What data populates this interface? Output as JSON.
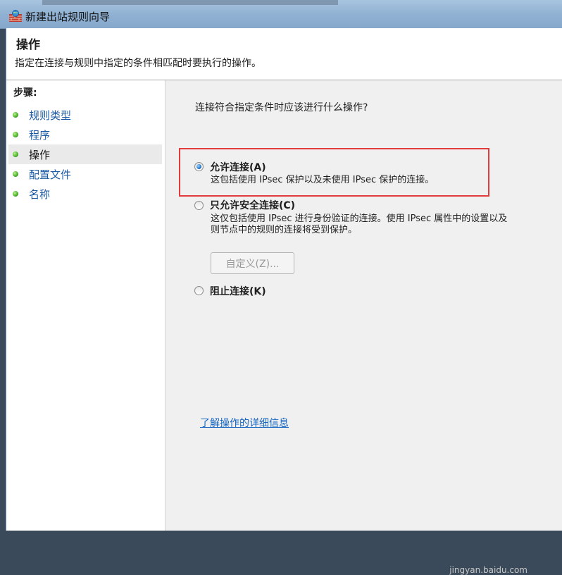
{
  "window": {
    "title": "新建出站规则向导"
  },
  "header": {
    "title": "操作",
    "description": "指定在连接与规则中指定的条件相匹配时要执行的操作。"
  },
  "steps": {
    "title": "步骤:",
    "items": [
      {
        "label": "规则类型"
      },
      {
        "label": "程序"
      },
      {
        "label": "操作"
      },
      {
        "label": "配置文件"
      },
      {
        "label": "名称"
      }
    ]
  },
  "main": {
    "question": "连接符合指定条件时应该进行什么操作?",
    "options": [
      {
        "label": "允许连接(A)",
        "description_lines": [
          "这包括使用 IPsec 保护以及未使用 IPsec 保护的连接。"
        ],
        "checked": true
      },
      {
        "label": "只允许安全连接(C)",
        "description_lines": [
          "这仅包括使用 IPsec 进行身份验证的连接。使用 IPsec 属性中的设置以及",
          "则节点中的规则的连接将受到保护。"
        ],
        "checked": false
      },
      {
        "label": "阻止连接(K)",
        "description_lines": [],
        "checked": false
      }
    ],
    "customize_button": "自定义(Z)...",
    "learn_more_link": "了解操作的详细信息"
  },
  "watermark": "jingyan.baidu.com",
  "icons": {
    "window": "firewall-icon",
    "steps": "green-dot-icon"
  },
  "colors": {
    "link": "#1565c0",
    "highlight": "#e23b3b",
    "step_dot": "#4aae2a"
  }
}
